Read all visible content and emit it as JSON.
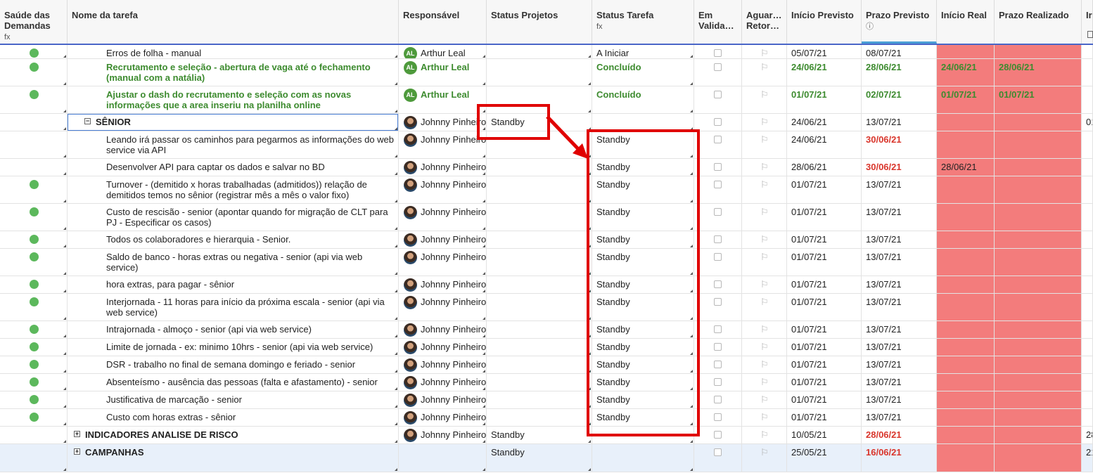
{
  "columns": [
    {
      "key": "saude",
      "label": "Saúde das Demandas",
      "sub": "fx"
    },
    {
      "key": "nome",
      "label": "Nome da tarefa",
      "sub": ""
    },
    {
      "key": "resp",
      "label": "Responsável",
      "sub": ""
    },
    {
      "key": "sproj",
      "label": "Status Projetos",
      "sub": ""
    },
    {
      "key": "starefa",
      "label": "Status Tarefa",
      "sub": "fx"
    },
    {
      "key": "emval",
      "label": "Em Valida…",
      "sub": ""
    },
    {
      "key": "aguar",
      "label": "Aguar… Retor…",
      "sub": ""
    },
    {
      "key": "iniprev",
      "label": "Início Previsto",
      "sub": ""
    },
    {
      "key": "prazoprev",
      "label": "Prazo Previsto",
      "sub": "ⓘ"
    },
    {
      "key": "inireal",
      "label": "Início Real",
      "sub": ""
    },
    {
      "key": "prazoreal",
      "label": "Prazo Realizado",
      "sub": ""
    },
    {
      "key": "extra",
      "label": "Ir",
      "sub": ""
    }
  ],
  "rows": [
    {
      "health": true,
      "name": "Erros de folha - manual",
      "style": "normal",
      "resp": "Arthur Leal",
      "avatar": "AL",
      "sproj": "",
      "starefa": "A Iniciar",
      "iniprev": "05/07/21",
      "prazoprev": "08/07/21",
      "prazoprev_style": "normal",
      "inireal": "",
      "prazoreal": "",
      "extra": ""
    },
    {
      "health": true,
      "name": "Recrutamento e seleção - abertura de vaga até o fechamento (manual com a natália)",
      "style": "green",
      "resp": "Arthur Leal",
      "avatar": "AL",
      "sproj": "",
      "starefa": "Concluído",
      "iniprev": "24/06/21",
      "prazoprev": "28/06/21",
      "prazoprev_style": "green",
      "inireal": "24/06/21",
      "prazoreal": "28/06/21",
      "extra": ""
    },
    {
      "health": true,
      "name": "Ajustar o dash do recrutamento e seleção com as novas informações que a area inseriu na planilha online",
      "style": "green",
      "resp": "Arthur Leal",
      "avatar": "AL",
      "sproj": "",
      "starefa": "Concluído",
      "iniprev": "01/07/21",
      "prazoprev": "02/07/21",
      "prazoprev_style": "green",
      "inireal": "01/07/21",
      "prazoreal": "01/07/21",
      "extra": ""
    },
    {
      "health": false,
      "name": "SÊNIOR",
      "style": "parent",
      "expander": "−",
      "resp": "Johnny Pinheiro",
      "avatar": "JP",
      "sproj": "Standby",
      "starefa": "",
      "iniprev": "24/06/21",
      "prazoprev": "13/07/21",
      "prazoprev_style": "normal",
      "inireal": "",
      "prazoreal": "",
      "extra": "01"
    },
    {
      "health": false,
      "name": "Leando irá passar os caminhos para pegarmos as informações do web service via API",
      "style": "normal",
      "resp": "Johnny Pinheiro",
      "avatar": "JP",
      "sproj": "",
      "starefa": "Standby",
      "iniprev": "24/06/21",
      "prazoprev": "30/06/21",
      "prazoprev_style": "red",
      "inireal": "",
      "prazoreal": "",
      "extra": ""
    },
    {
      "health": false,
      "name": "Desenvolver API para captar os dados e salvar no BD",
      "style": "normal",
      "resp": "Johnny Pinheiro",
      "avatar": "JP",
      "sproj": "",
      "starefa": "Standby",
      "iniprev": "28/06/21",
      "prazoprev": "30/06/21",
      "prazoprev_style": "red",
      "inireal": "28/06/21",
      "prazoreal": "",
      "extra": ""
    },
    {
      "health": true,
      "name": "Turnover - (demitido x horas trabalhadas (admitidos)) relação de demitidos temos no sênior (registrar mês a mês o valor fixo)",
      "style": "normal",
      "resp": "Johnny Pinheiro",
      "avatar": "JP",
      "sproj": "",
      "starefa": "Standby",
      "iniprev": "01/07/21",
      "prazoprev": "13/07/21",
      "prazoprev_style": "normal",
      "inireal": "",
      "prazoreal": "",
      "extra": ""
    },
    {
      "health": true,
      "name": "Custo de rescisão - senior (apontar quando for migração de CLT para PJ - Especificar os casos)",
      "style": "normal",
      "resp": "Johnny Pinheiro",
      "avatar": "JP",
      "sproj": "",
      "starefa": "Standby",
      "iniprev": "01/07/21",
      "prazoprev": "13/07/21",
      "prazoprev_style": "normal",
      "inireal": "",
      "prazoreal": "",
      "extra": ""
    },
    {
      "health": true,
      "name": "Todos os colaboradores e hierarquia - Senior.",
      "style": "normal",
      "resp": "Johnny Pinheiro",
      "avatar": "JP",
      "sproj": "",
      "starefa": "Standby",
      "iniprev": "01/07/21",
      "prazoprev": "13/07/21",
      "prazoprev_style": "normal",
      "inireal": "",
      "prazoreal": "",
      "extra": ""
    },
    {
      "health": true,
      "name": "Saldo de banco - horas extras ou negativa - senior (api via web service)",
      "style": "normal",
      "resp": "Johnny Pinheiro",
      "avatar": "JP",
      "sproj": "",
      "starefa": "Standby",
      "iniprev": "01/07/21",
      "prazoprev": "13/07/21",
      "prazoprev_style": "normal",
      "inireal": "",
      "prazoreal": "",
      "extra": ""
    },
    {
      "health": true,
      "name": "hora extras, para pagar - sênior",
      "style": "normal",
      "resp": "Johnny Pinheiro",
      "avatar": "JP",
      "sproj": "",
      "starefa": "Standby",
      "iniprev": "01/07/21",
      "prazoprev": "13/07/21",
      "prazoprev_style": "normal",
      "inireal": "",
      "prazoreal": "",
      "extra": ""
    },
    {
      "health": true,
      "name": "Interjornada - 11 horas para início da próxima escala - senior (api via web service)",
      "style": "normal",
      "resp": "Johnny Pinheiro",
      "avatar": "JP",
      "sproj": "",
      "starefa": "Standby",
      "iniprev": "01/07/21",
      "prazoprev": "13/07/21",
      "prazoprev_style": "normal",
      "inireal": "",
      "prazoreal": "",
      "extra": ""
    },
    {
      "health": true,
      "name": "Intrajornada - almoço - senior (api via web service)",
      "style": "normal",
      "resp": "Johnny Pinheiro",
      "avatar": "JP",
      "sproj": "",
      "starefa": "Standby",
      "iniprev": "01/07/21",
      "prazoprev": "13/07/21",
      "prazoprev_style": "normal",
      "inireal": "",
      "prazoreal": "",
      "extra": ""
    },
    {
      "health": true,
      "name": "Limite de jornada - ex: minimo 10hrs - senior (api via web service)",
      "style": "normal",
      "resp": "Johnny Pinheiro",
      "avatar": "JP",
      "sproj": "",
      "starefa": "Standby",
      "iniprev": "01/07/21",
      "prazoprev": "13/07/21",
      "prazoprev_style": "normal",
      "inireal": "",
      "prazoreal": "",
      "extra": ""
    },
    {
      "health": true,
      "name": "DSR - trabalho no final de semana domingo e feriado - senior",
      "style": "normal",
      "resp": "Johnny Pinheiro",
      "avatar": "JP",
      "sproj": "",
      "starefa": "Standby",
      "iniprev": "01/07/21",
      "prazoprev": "13/07/21",
      "prazoprev_style": "normal",
      "inireal": "",
      "prazoreal": "",
      "extra": ""
    },
    {
      "health": true,
      "name": "Absenteísmo - ausência das pessoas (falta e afastamento) - senior",
      "style": "normal",
      "resp": "Johnny Pinheiro",
      "avatar": "JP",
      "sproj": "",
      "starefa": "Standby",
      "iniprev": "01/07/21",
      "prazoprev": "13/07/21",
      "prazoprev_style": "normal",
      "inireal": "",
      "prazoreal": "",
      "extra": ""
    },
    {
      "health": true,
      "name": "Justificativa de marcação - senior",
      "style": "normal",
      "resp": "Johnny Pinheiro",
      "avatar": "JP",
      "sproj": "",
      "starefa": "Standby",
      "iniprev": "01/07/21",
      "prazoprev": "13/07/21",
      "prazoprev_style": "normal",
      "inireal": "",
      "prazoreal": "",
      "extra": ""
    },
    {
      "health": true,
      "name": "Custo com horas extras - sênior",
      "style": "normal",
      "resp": "Johnny Pinheiro",
      "avatar": "JP",
      "sproj": "",
      "starefa": "Standby",
      "iniprev": "01/07/21",
      "prazoprev": "13/07/21",
      "prazoprev_style": "normal",
      "inireal": "",
      "prazoreal": "",
      "extra": ""
    },
    {
      "health": false,
      "name": "INDICADORES ANALISE DE RISCO",
      "style": "parent-top",
      "expander": "+",
      "resp": "Johnny Pinheiro",
      "avatar": "JP",
      "sproj": "Standby",
      "starefa": "",
      "iniprev": "10/05/21",
      "prazoprev": "28/06/21",
      "prazoprev_style": "red",
      "inireal": "",
      "prazoreal": "",
      "extra": "28"
    },
    {
      "health": false,
      "name": "CAMPANHAS",
      "style": "parent-top",
      "expander": "+",
      "resp": "",
      "avatar": "",
      "sproj": "Standby",
      "starefa": "",
      "iniprev": "25/05/21",
      "prazoprev": "16/06/21",
      "prazoprev_style": "red",
      "inireal": "",
      "prazoreal": "",
      "extra": "21",
      "highlight": true
    }
  ],
  "annotation": {
    "color": "#e00000"
  }
}
